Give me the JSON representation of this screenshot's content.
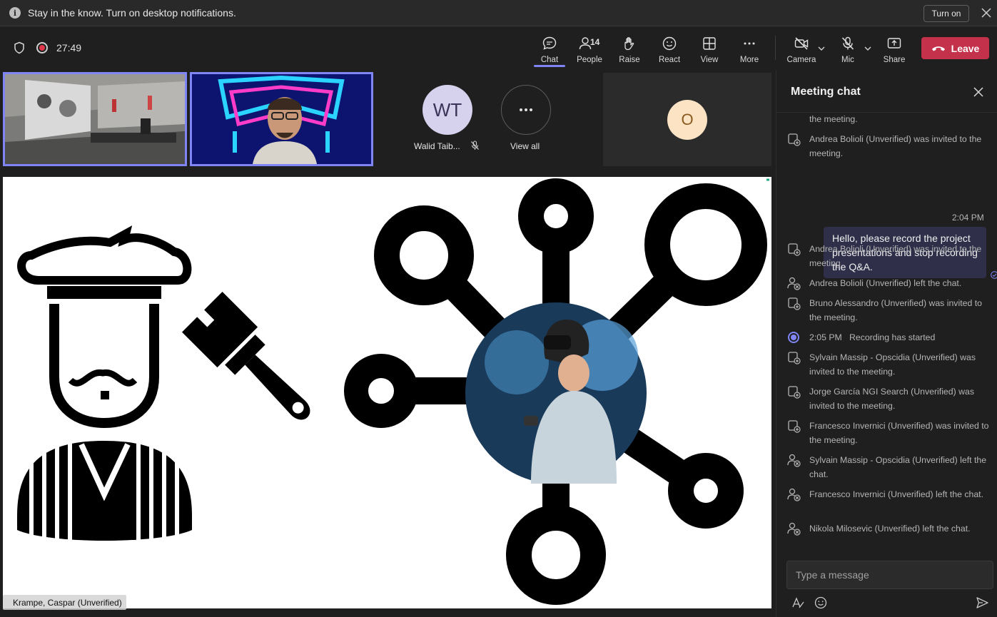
{
  "notification": {
    "message": "Stay in the know. Turn on desktop notifications.",
    "action_label": "Turn on"
  },
  "toolbar": {
    "timer": "27:49",
    "buttons": {
      "chat": "Chat",
      "people": "People",
      "people_count": "14",
      "raise": "Raise",
      "react": "React",
      "view": "View",
      "more": "More",
      "camera": "Camera",
      "mic": "Mic",
      "share": "Share"
    },
    "leave_label": "Leave",
    "colors": {
      "accent": "#7f85f5",
      "leave": "#c4314b",
      "recording": "#e0384a"
    }
  },
  "participants": {
    "walid": {
      "initials": "WT",
      "name": "Walid Taib..."
    },
    "view_all": "View all",
    "other": {
      "initials": "O"
    }
  },
  "stage": {
    "presenter_label": "Krampe, Caspar (Unverified)"
  },
  "chat": {
    "title": "Meeting chat",
    "messages": [
      {
        "kind": "invite",
        "text": "the meeting."
      },
      {
        "kind": "invite",
        "text": "Andrea Bolioli (Unverified) was invited to the meeting."
      },
      {
        "kind": "own",
        "time": "2:04 PM",
        "text": "Hello, please record the project presentations and stop recording the Q&A."
      },
      {
        "kind": "invite",
        "text": "Andrea Bolioli (Unverified) was invited to the meeting."
      },
      {
        "kind": "left",
        "text": "Andrea Bolioli (Unverified) left the chat."
      },
      {
        "kind": "invite",
        "text": "Bruno Alessandro (Unverified) was invited to the meeting."
      },
      {
        "kind": "recording",
        "time": "2:05 PM",
        "text": "Recording has started"
      },
      {
        "kind": "invite",
        "text": "Sylvain Massip - Opscidia (Unverified) was invited to the meeting."
      },
      {
        "kind": "invite",
        "text": "Jorge García NGI Search (Unverified) was invited to the meeting."
      },
      {
        "kind": "invite",
        "text": "Francesco Invernici (Unverified) was invited to the meeting."
      },
      {
        "kind": "left",
        "text": "Sylvain Massip - Opscidia (Unverified) left the chat."
      },
      {
        "kind": "left",
        "text": "Francesco Invernici (Unverified) left the chat."
      },
      {
        "kind": "left",
        "text": "Nikola Milosevic (Unverified) left the chat."
      }
    ],
    "input_placeholder": "Type a message"
  }
}
